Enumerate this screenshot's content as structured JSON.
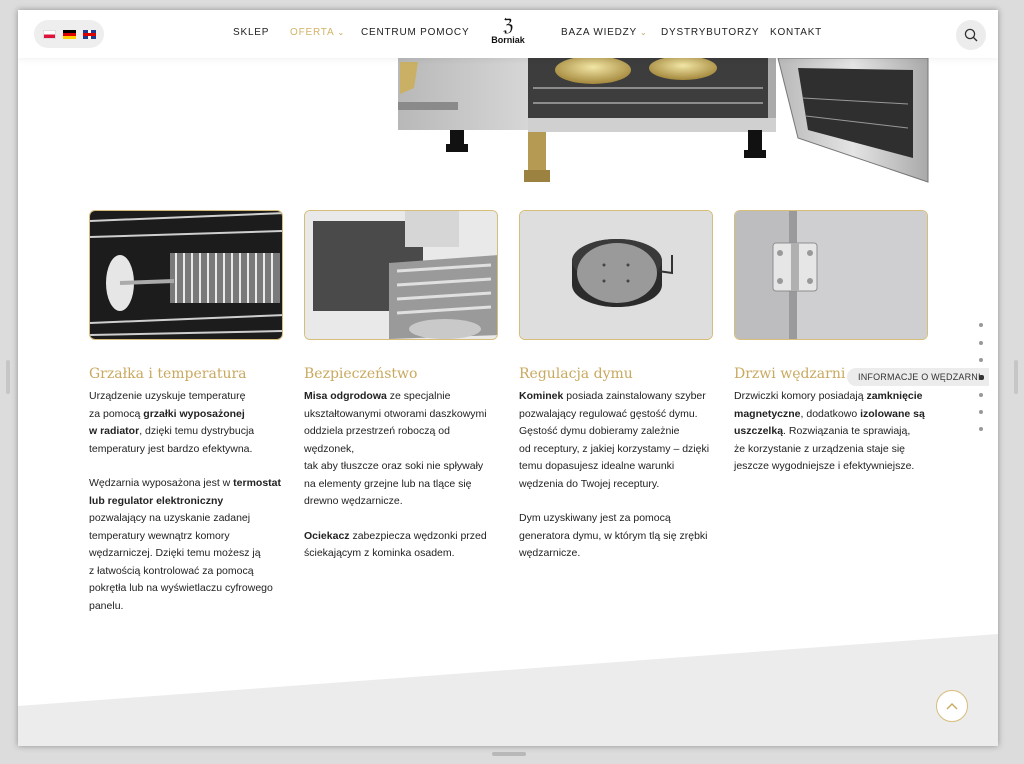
{
  "languages": [
    {
      "code": "pl",
      "icon": "flag-pl-icon"
    },
    {
      "code": "de",
      "icon": "flag-de-icon"
    },
    {
      "code": "en",
      "icon": "flag-gb-icon"
    }
  ],
  "nav": {
    "sklep": "SKLEP",
    "oferta": "OFERTA",
    "centrum": "CENTRUM POMOCY",
    "baza": "BAZA WIEDZY",
    "dystrybutorzy": "DYSTRYBUTORZY",
    "kontakt": "KONTAKT",
    "active_color": "#d2b36a"
  },
  "logo": {
    "text": "Borniak",
    "mark": "ℨ"
  },
  "search": {
    "icon": "search-icon"
  },
  "features": [
    {
      "title": "Grzałka i temperatura",
      "p1": [
        {
          "t": "Urządzenie uzyskuje temperaturę"
        },
        {
          "t": "za pomocą "
        },
        {
          "b": "grzałki wyposażonej"
        },
        {
          "b": "w radiator"
        },
        {
          "t": ", dzięki temu dystrybucja"
        },
        {
          "t": "temperatury jest bardzo efektywna."
        }
      ],
      "p2": [
        {
          "t": "Wędzarnia wyposażona jest w "
        },
        {
          "b": "termostat"
        },
        {
          "b": "lub regulator elektroniczny"
        },
        {
          "t": "pozwalający na uzyskanie zadanej"
        },
        {
          "t": "temperatury wewnątrz komory"
        },
        {
          "t": "wędzarniczej. Dzięki temu możesz ją"
        },
        {
          "t": "z łatwością kontrolować za pomocą"
        },
        {
          "t": "pokrętła lub na wyświetlaczu cyfrowego"
        },
        {
          "t": "panelu."
        }
      ]
    },
    {
      "title": "Bezpieczeństwo",
      "p1": [
        {
          "b": "Misa odgrodowa"
        },
        {
          "t": " ze specjalnie"
        },
        {
          "t": "ukształtowanymi otworami daszkowymi"
        },
        {
          "t": "oddziela przestrzeń roboczą od wędzonek,"
        },
        {
          "t": "tak aby tłuszcze oraz soki nie spływały"
        },
        {
          "t": "na elementy grzejne lub na tlące się"
        },
        {
          "t": "drewno wędzarnicze."
        }
      ],
      "p2": [
        {
          "b": "Ociekacz"
        },
        {
          "t": " zabezpiecza wędzonki przed"
        },
        {
          "t": "ściekającym z kominka osadem."
        }
      ]
    },
    {
      "title": "Regulacja dymu",
      "p1": [
        {
          "b": "Kominek"
        },
        {
          "t": " posiada zainstalowany szyber"
        },
        {
          "t": "pozwalający regulować gęstość dymu."
        },
        {
          "t": "Gęstość dymu dobieramy zależnie"
        },
        {
          "t": "od receptury, z jakiej korzystamy – dzięki"
        },
        {
          "t": "temu dopasujesz idealne warunki"
        },
        {
          "t": "wędzenia do Twojej receptury."
        }
      ],
      "p2": [
        {
          "t": "Dym uzyskiwany jest za pomocą"
        },
        {
          "t": "generatora dymu, w którym tlą się zrębki"
        },
        {
          "t": "wędzarnicze."
        }
      ]
    },
    {
      "title": "Drzwi wędzarni",
      "p1": [
        {
          "t": "Drzwiczki komory posiadają "
        },
        {
          "b": "zamknięcie"
        },
        {
          "b": "magnetyczne"
        },
        {
          "t": ", dodatkowo "
        },
        {
          "b": "izolowane są"
        },
        {
          "b": "uszczelką"
        },
        {
          "t": ". Rozwiązania te sprawiają,"
        },
        {
          "t": "że korzystanie z urządzenia staje się"
        },
        {
          "t": "jeszcze wygodniejsze i efektywniejsze."
        }
      ],
      "p2": []
    }
  ],
  "section_nav": {
    "active_label": "INFORMACJE O WĘDZARNI",
    "count": 7,
    "active_index": 3
  },
  "scroll_top": {
    "icon": "chevron-up-icon"
  },
  "colors": {
    "accent": "#c9a95f",
    "border": "#d7bd7a"
  }
}
